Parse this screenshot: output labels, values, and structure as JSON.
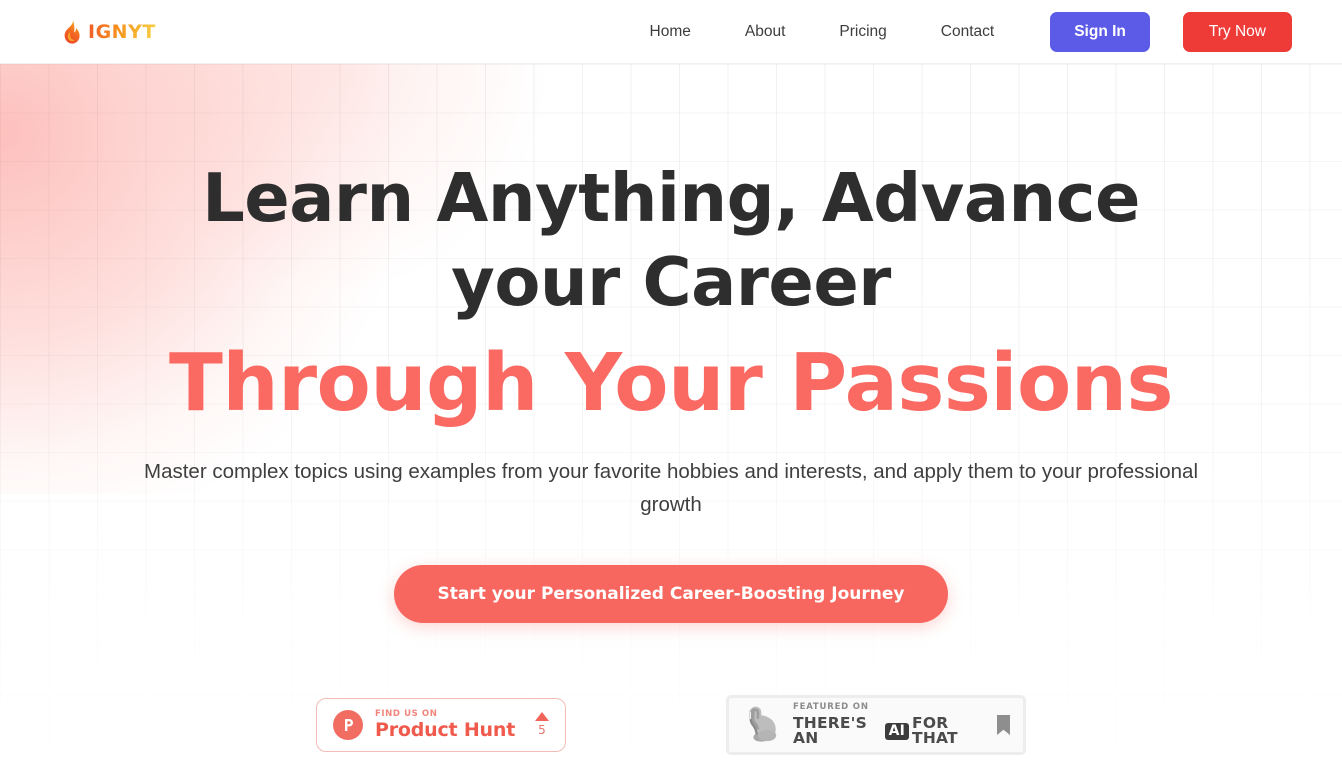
{
  "header": {
    "brand": {
      "name": "IGNYT",
      "icon": "flame-icon"
    },
    "nav": [
      {
        "label": "Home"
      },
      {
        "label": "About"
      },
      {
        "label": "Pricing"
      },
      {
        "label": "Contact"
      }
    ],
    "sign_in_label": "Sign In",
    "try_now_label": "Try Now",
    "sign_in_color": "#5B5BE8",
    "try_now_color": "#EE3B38"
  },
  "hero": {
    "title_line1": "Learn Anything, Advance your",
    "title_line2": "Career",
    "title_accent": "Through Your Passions",
    "subtitle": "Master complex topics using examples from your favorite hobbies and interests, and apply them to your professional growth",
    "cta_label": "Start your Personalized Career-Boosting Journey",
    "accent_color": "#FA6A62",
    "heading_color": "#2E2E2E"
  },
  "badges": {
    "product_hunt": {
      "kicker": "FIND US ON",
      "name": "Product Hunt",
      "upvote_count": "5",
      "logo_icon": "product-hunt-logo-icon",
      "arrow_icon": "upvote-arrow-icon"
    },
    "theres_an_ai_for_that": {
      "kicker": "FEATURED ON",
      "name_part1": "THERE'S AN",
      "name_badge": "AI",
      "name_part2": "FOR THAT",
      "arm_icon": "flexed-bicep-icon",
      "bookmark_icon": "bookmark-icon"
    }
  }
}
